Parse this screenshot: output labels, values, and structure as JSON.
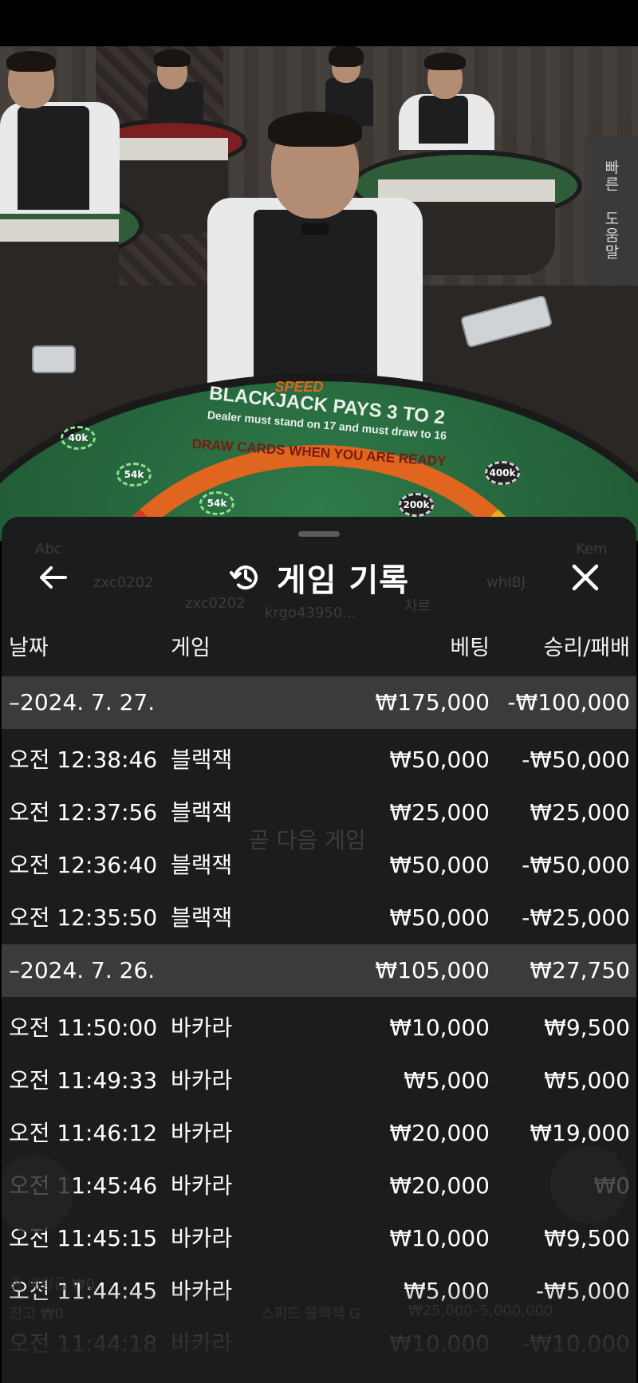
{
  "help_tab": {
    "line1": "빠른",
    "line2": "도움말"
  },
  "scene_text": {
    "brand": "SPEED",
    "headline": "BLACKJACK PAYS 3 TO 2",
    "rule": "Dealer must stand on 17 and must draw to 16",
    "banner": "DRAW CARDS WHEN YOU ARE READY",
    "chips": [
      "40k",
      "54k",
      "54k",
      "200k",
      "400k"
    ]
  },
  "header": {
    "title": "게임 기록",
    "back_icon": "arrow-left-icon",
    "history_icon": "history-clock-icon",
    "close_icon": "close-x-icon"
  },
  "columns": {
    "date": "날짜",
    "game": "게임",
    "bet": "베팅",
    "win_loss": "승리/패배"
  },
  "groups": [
    {
      "date": "–2024. 7. 27.",
      "bet_total": "₩175,000",
      "result_total": "-₩100,000",
      "rows": [
        {
          "time": "오전 12:38:46",
          "game": "블랙잭",
          "bet": "₩50,000",
          "result": "-₩50,000"
        },
        {
          "time": "오전 12:37:56",
          "game": "블랙잭",
          "bet": "₩25,000",
          "result": "₩25,000"
        },
        {
          "time": "오전 12:36:40",
          "game": "블랙잭",
          "bet": "₩50,000",
          "result": "-₩50,000"
        },
        {
          "time": "오전 12:35:50",
          "game": "블랙잭",
          "bet": "₩50,000",
          "result": "-₩25,000"
        }
      ]
    },
    {
      "date": "–2024. 7. 26.",
      "bet_total": "₩105,000",
      "result_total": "₩27,750",
      "rows": [
        {
          "time": "오전 11:50:00",
          "game": "바카라",
          "bet": "₩10,000",
          "result": "₩9,500"
        },
        {
          "time": "오전 11:49:33",
          "game": "바카라",
          "bet": "₩5,000",
          "result": "₩5,000"
        },
        {
          "time": "오전 11:46:12",
          "game": "바카라",
          "bet": "₩20,000",
          "result": "₩19,000"
        },
        {
          "time": "오전 11:45:46",
          "game": "바카라",
          "bet": "₩20,000",
          "result": "₩0"
        },
        {
          "time": "오전 11:45:15",
          "game": "바카라",
          "bet": "₩10,000",
          "result": "₩9,500"
        },
        {
          "time": "오전 11:44:45",
          "game": "바카라",
          "bet": "₩5,000",
          "result": "-₩5,000"
        },
        {
          "time": "오전 11:44:18",
          "game": "바카라",
          "bet": "₩10,000",
          "result": "-₩10,000"
        }
      ]
    }
  ],
  "underlay": {
    "seat1": "Abc",
    "seat2": "Kem",
    "player1": "zxc0202",
    "player2": "zxc0202",
    "player3": "krgo43950...",
    "player4": "whIBJ",
    "seat_label": "차르",
    "next_game": "곧 다음 게임",
    "total_bet": "총 베팅금 ₩0",
    "balance": "잔고 ₩0",
    "game_name": "스피드 블랙잭 G",
    "limits": "₩25,000–5,000,000"
  }
}
